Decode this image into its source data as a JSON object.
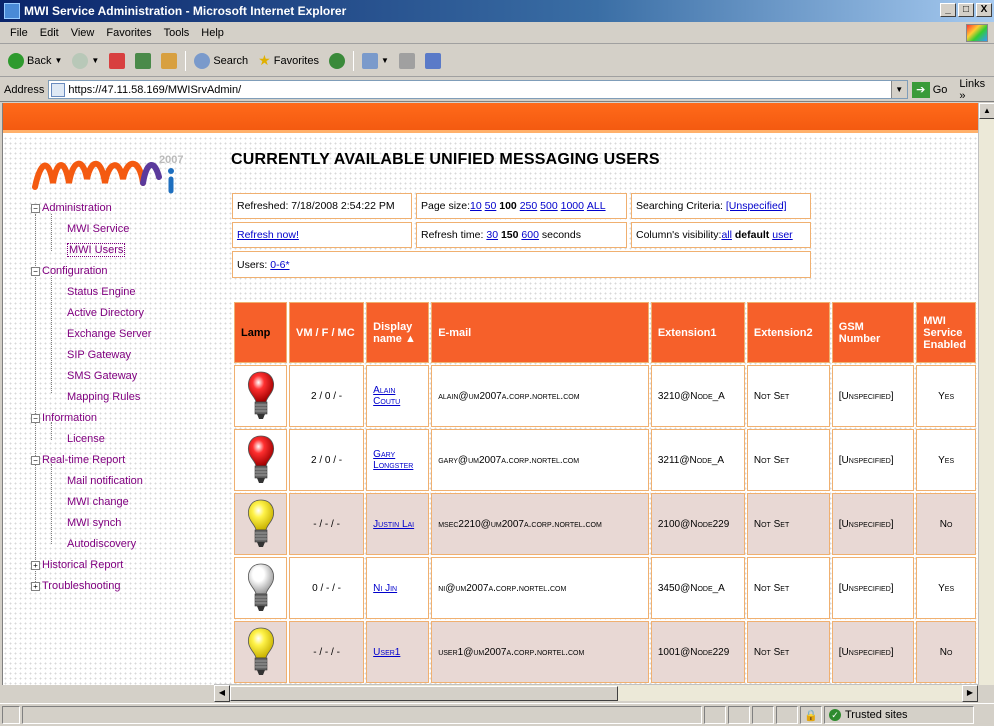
{
  "window": {
    "title": "MWI Service Administration - Microsoft Internet Explorer",
    "buttons": [
      "_",
      "□",
      "X"
    ]
  },
  "menu": [
    "File",
    "Edit",
    "View",
    "Favorites",
    "Tools",
    "Help"
  ],
  "toolbar": {
    "back": "Back",
    "search": "Search",
    "favorites": "Favorites"
  },
  "address": {
    "label": "Address",
    "url": "https://47.11.58.169/MWISrvAdmin/",
    "go": "Go",
    "links": "Links"
  },
  "logo": {
    "text": "mwi",
    "year": "2007"
  },
  "tree": {
    "administration": "Administration",
    "mwi_service": "MWI Service",
    "mwi_users": "MWI Users",
    "configuration": "Configuration",
    "status_engine": "Status Engine",
    "active_directory": "Active Directory",
    "exchange_server": "Exchange Server",
    "sip_gateway": "SIP Gateway",
    "sms_gateway": "SMS Gateway",
    "mapping_rules": "Mapping Rules",
    "information": "Information",
    "license": "License",
    "realtime_report": "Real-time Report",
    "mail_notification": "Mail notification",
    "mwi_change": "MWI change",
    "mwi_synch": "MWI synch",
    "autodiscovery": "Autodiscovery",
    "historical_report": "Historical Report",
    "troubleshooting": "Troubleshooting"
  },
  "heading": "CURRENTLY AVAILABLE UNIFIED MESSAGING USERS",
  "info": {
    "refreshed": "Refreshed: 7/18/2008 2:54:22 PM",
    "page_size_label": "Page size:",
    "page_sizes": [
      "10",
      "50",
      "100",
      "250",
      "500",
      "1000",
      "ALL"
    ],
    "search_label": "Searching Criteria:",
    "search_value": "[Unspecified]",
    "refresh_now": "Refresh now!",
    "refresh_time_label": "Refresh time:",
    "refresh_times": [
      "30",
      "150",
      "600"
    ],
    "seconds": "seconds",
    "visibility_label": "Column's visibility:",
    "visibility_options": [
      "all",
      "default",
      "user"
    ],
    "users_label": "Users:",
    "users_value": "0-6*"
  },
  "table": {
    "headers": [
      "Lamp",
      "VM / F / MC",
      "Display name ▲",
      "E-mail",
      "Extension1",
      "Extension2",
      "GSM Number",
      "MWI Service Enabled"
    ],
    "rows": [
      {
        "lamp": "red",
        "vm": "2 / 0 / -",
        "name": "Alain Coutu",
        "email": "alain@um2007a.corp.nortel.com",
        "ext1": "3210@Node_A",
        "ext2": "Not Set",
        "gsm": "[Unspecified]",
        "enabled": "Yes"
      },
      {
        "lamp": "red",
        "vm": "2 / 0 / -",
        "name": "Gary Longster",
        "email": "gary@um2007a.corp.nortel.com",
        "ext1": "3211@Node_A",
        "ext2": "Not Set",
        "gsm": "[Unspecified]",
        "enabled": "Yes"
      },
      {
        "lamp": "yellow",
        "vm": "- / - / -",
        "name": "Justin Lai",
        "email": "msec2210@um2007a.corp.nortel.com",
        "ext1": "2100@Node229",
        "ext2": "Not Set",
        "gsm": "[Unspecified]",
        "enabled": "No"
      },
      {
        "lamp": "white",
        "vm": "0 / - / -",
        "name": "Ni Jin",
        "email": "ni@um2007a.corp.nortel.com",
        "ext1": "3450@Node_A",
        "ext2": "Not Set",
        "gsm": "[Unspecified]",
        "enabled": "Yes"
      },
      {
        "lamp": "yellow",
        "vm": "- / - / -",
        "name": "User1",
        "email": "user1@um2007a.corp.nortel.com",
        "ext1": "1001@Node229",
        "ext2": "Not Set",
        "gsm": "[Unspecified]",
        "enabled": "No"
      }
    ]
  },
  "status": {
    "zone": "Trusted sites"
  },
  "colors": {
    "banner": "#f45a10",
    "header_cell": "#f6602a",
    "pink_row": "#e8d8d4",
    "link": "#0000cc",
    "tree": "#800080"
  }
}
